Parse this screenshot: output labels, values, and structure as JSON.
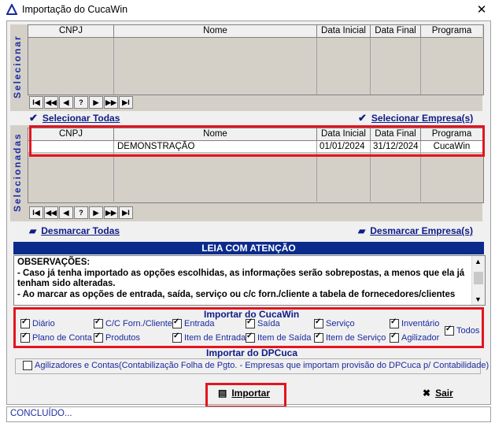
{
  "window": {
    "title": "Importação do CucaWin",
    "close_glyph": "✕"
  },
  "selecionar": {
    "side_label": "Selecionar",
    "columns": [
      "CNPJ",
      "Nome",
      "Data Inicial",
      "Data Final",
      "Programa"
    ],
    "rows": []
  },
  "nav": [
    "I◀",
    "◀◀",
    "◀",
    "?",
    "▶",
    "▶▶",
    "▶I"
  ],
  "actions": {
    "select_all": "Selecionar Todas",
    "select_companies": "Selecionar Empresa(s)",
    "unselect_all": "Desmarcar Todas",
    "unselect_companies": "Desmarcar Empresa(s)"
  },
  "selecionadas": {
    "side_label": "Selecionadas",
    "columns": [
      "CNPJ",
      "Nome",
      "Data Inicial",
      "Data Final",
      "Programa"
    ],
    "rows": [
      {
        "cnpj": "",
        "nome": "DEMONSTRAÇÃO",
        "data_inicial": "01/01/2024",
        "data_final": "31/12/2024",
        "programa": "CucaWin"
      }
    ]
  },
  "notice": {
    "header": "LEIA COM ATENÇÃO",
    "line1": "OBSERVAÇÕES:",
    "line2": " - Caso já tenha importado as opções escolhidas, as informações serão sobrepostas, a menos que ela já tenham sido alteradas.",
    "line3": " - Ao marcar as opções de entrada, saída, serviço ou c/c forn./cliente a tabela de fornecedores/clientes"
  },
  "import_cucawin": {
    "title": "Importar do CucaWin",
    "row1": [
      {
        "label": "Diário",
        "checked": true
      },
      {
        "label": "C/C Forn./Cliente",
        "checked": true
      },
      {
        "label": "Entrada",
        "checked": true
      },
      {
        "label": "Saída",
        "checked": true
      },
      {
        "label": "Serviço",
        "checked": true
      },
      {
        "label": "Inventário",
        "checked": true
      }
    ],
    "row2": [
      {
        "label": "Plano de Conta",
        "checked": true
      },
      {
        "label": "Produtos",
        "checked": true
      },
      {
        "label": "Item de Entrada",
        "checked": true
      },
      {
        "label": "Item de Saída",
        "checked": true
      },
      {
        "label": "Item de Serviço",
        "checked": true
      },
      {
        "label": "Agilizador",
        "checked": true
      }
    ],
    "all": {
      "label": "Todos",
      "checked": true
    }
  },
  "import_dpcuca": {
    "title": "Importar do DPCuca",
    "option": {
      "label": "Agilizadores e Contas(Contabilização Folha de Pgto. - Empresas que importam provisão do DPCuca p/ Contabilidade)",
      "checked": false
    }
  },
  "buttons": {
    "import": "Importar",
    "exit": "Sair"
  },
  "status": "CONCLUÍDO...",
  "colors": {
    "accent": "#0b2b8c",
    "highlight": "#e3151e",
    "label_blue": "#1d2fa4"
  }
}
